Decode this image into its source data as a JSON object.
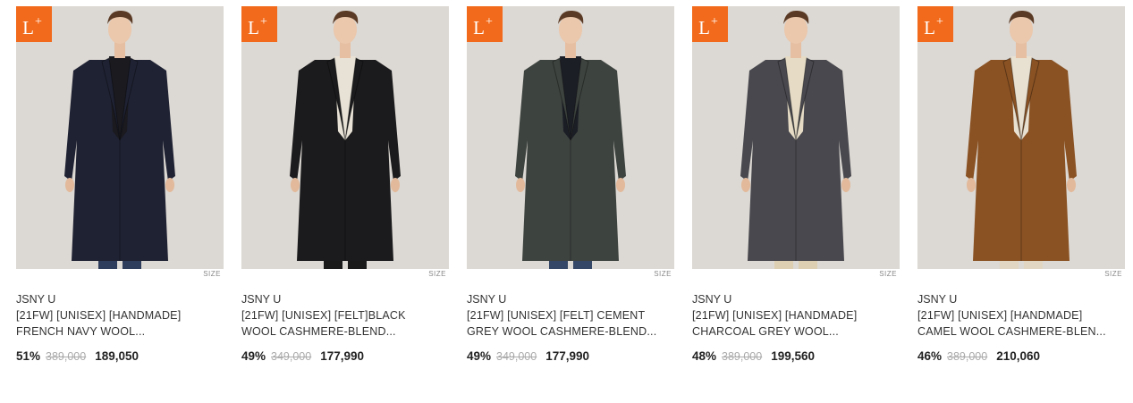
{
  "products": [
    {
      "badge": "L",
      "badge_sup": "+",
      "size_label": "SIZE",
      "brand": "JSNY U",
      "title_line1": "[21FW] [UNISEX] [HANDMADE]",
      "title_line2": "FRENCH NAVY WOOL...",
      "discount": "51%",
      "original_price": "389,000",
      "sale_price": "189,050",
      "coat_color": "#1f2233",
      "inner_color": "#1a1a1f",
      "pants_color": "#2f3d5c"
    },
    {
      "badge": "L",
      "badge_sup": "+",
      "size_label": "SIZE",
      "brand": "JSNY U",
      "title_line1": "[21FW] [UNISEX] [FELT]BLACK",
      "title_line2": "WOOL CASHMERE-BLEND...",
      "discount": "49%",
      "original_price": "349,000",
      "sale_price": "177,990",
      "coat_color": "#1b1b1d",
      "inner_color": "#e8e2d6",
      "pants_color": "#1a1a1a"
    },
    {
      "badge": "L",
      "badge_sup": "+",
      "size_label": "SIZE",
      "brand": "JSNY U",
      "title_line1": "[21FW] [UNISEX] [FELT] CEMENT",
      "title_line2": "GREY WOOL CASHMERE-BLEND...",
      "discount": "49%",
      "original_price": "349,000",
      "sale_price": "177,990",
      "coat_color": "#3d433f",
      "inner_color": "#1c1e26",
      "pants_color": "#354766"
    },
    {
      "badge": "L",
      "badge_sup": "+",
      "size_label": "SIZE",
      "brand": "JSNY U",
      "title_line1": "[21FW] [UNISEX] [HANDMADE]",
      "title_line2": "CHARCOAL GREY WOOL...",
      "discount": "48%",
      "original_price": "389,000",
      "sale_price": "199,560",
      "coat_color": "#48484e",
      "inner_color": "#e6dcc6",
      "pants_color": "#ddd0b2"
    },
    {
      "badge": "L",
      "badge_sup": "+",
      "size_label": "SIZE",
      "brand": "JSNY U",
      "title_line1": "[21FW] [UNISEX] [HANDMADE]",
      "title_line2": "CAMEL WOOL CASHMERE-BLEN...",
      "discount": "46%",
      "original_price": "389,000",
      "sale_price": "210,060",
      "coat_color": "#8a5223",
      "inner_color": "#e8e0d0",
      "pants_color": "#e0d6c2"
    }
  ],
  "theme": {
    "badge_color": "#f26a1b",
    "photo_background": "#dcd8d3"
  }
}
